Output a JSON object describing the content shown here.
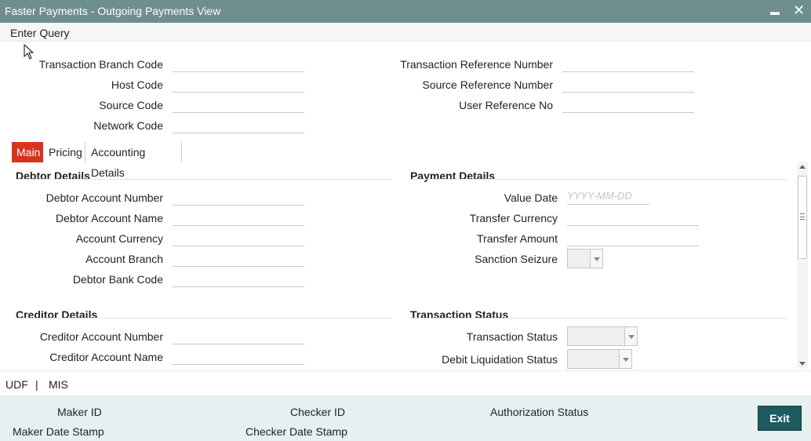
{
  "window": {
    "title": "Faster Payments - Outgoing Payments View",
    "minimize_glyph": "▬",
    "close_glyph": "✕"
  },
  "menu": {
    "enter_query": "Enter Query"
  },
  "header_fields": {
    "transaction_branch_code": "Transaction Branch Code",
    "host_code": "Host Code",
    "source_code": "Source Code",
    "network_code": "Network Code",
    "transaction_reference_number": "Transaction Reference Number",
    "source_reference_number": "Source Reference Number",
    "user_reference_no": "User Reference No"
  },
  "tabs": [
    "Main",
    "Pricing",
    "Accounting Details"
  ],
  "debtor": {
    "heading": "Debtor Details",
    "account_number": "Debtor Account Number",
    "account_name": "Debtor Account Name",
    "account_currency": "Account Currency",
    "account_branch": "Account Branch",
    "bank_code": "Debtor Bank Code"
  },
  "payment": {
    "heading": "Payment Details",
    "value_date": "Value Date",
    "value_date_placeholder": "YYYY-MM-DD",
    "transfer_currency": "Transfer Currency",
    "transfer_amount": "Transfer Amount",
    "sanction_seizure": "Sanction Seizure"
  },
  "creditor": {
    "heading": "Creditor Details",
    "account_number": "Creditor Account Number",
    "account_name": "Creditor Account Name"
  },
  "status": {
    "heading": "Transaction Status",
    "transaction_status": "Transaction Status",
    "debit_liquidation_status": "Debit Liquidation Status"
  },
  "subbar": {
    "udf": "UDF",
    "separator": "|",
    "mis": "MIS"
  },
  "footer": {
    "maker_id": "Maker ID",
    "maker_date_stamp": "Maker Date Stamp",
    "checker_id": "Checker ID",
    "checker_date_stamp": "Checker Date Stamp",
    "authorization_status": "Authorization Status",
    "exit": "Exit"
  },
  "colors": {
    "titlebar": "#6f8f8e",
    "active_tab": "#d9331e",
    "exit_button": "#1e5b61",
    "footer_bg": "#e7f0f1"
  }
}
